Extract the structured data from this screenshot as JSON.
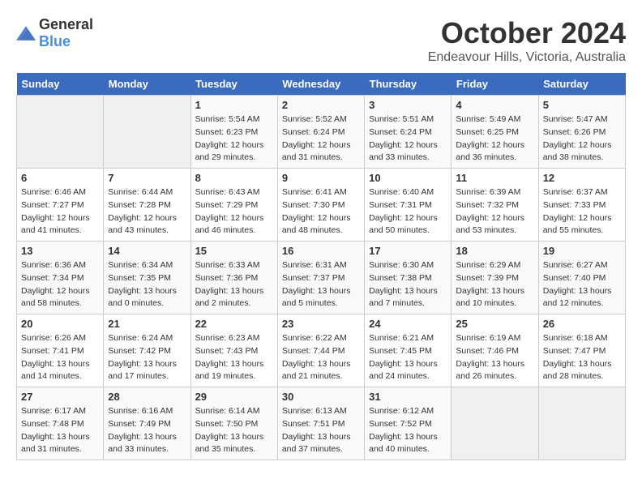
{
  "header": {
    "logo_general": "General",
    "logo_blue": "Blue",
    "month": "October 2024",
    "location": "Endeavour Hills, Victoria, Australia"
  },
  "weekdays": [
    "Sunday",
    "Monday",
    "Tuesday",
    "Wednesday",
    "Thursday",
    "Friday",
    "Saturday"
  ],
  "weeks": [
    [
      {
        "day": "",
        "sunrise": "",
        "sunset": "",
        "daylight": ""
      },
      {
        "day": "",
        "sunrise": "",
        "sunset": "",
        "daylight": ""
      },
      {
        "day": "1",
        "sunrise": "Sunrise: 5:54 AM",
        "sunset": "Sunset: 6:23 PM",
        "daylight": "Daylight: 12 hours and 29 minutes."
      },
      {
        "day": "2",
        "sunrise": "Sunrise: 5:52 AM",
        "sunset": "Sunset: 6:24 PM",
        "daylight": "Daylight: 12 hours and 31 minutes."
      },
      {
        "day": "3",
        "sunrise": "Sunrise: 5:51 AM",
        "sunset": "Sunset: 6:24 PM",
        "daylight": "Daylight: 12 hours and 33 minutes."
      },
      {
        "day": "4",
        "sunrise": "Sunrise: 5:49 AM",
        "sunset": "Sunset: 6:25 PM",
        "daylight": "Daylight: 12 hours and 36 minutes."
      },
      {
        "day": "5",
        "sunrise": "Sunrise: 5:47 AM",
        "sunset": "Sunset: 6:26 PM",
        "daylight": "Daylight: 12 hours and 38 minutes."
      }
    ],
    [
      {
        "day": "6",
        "sunrise": "Sunrise: 6:46 AM",
        "sunset": "Sunset: 7:27 PM",
        "daylight": "Daylight: 12 hours and 41 minutes."
      },
      {
        "day": "7",
        "sunrise": "Sunrise: 6:44 AM",
        "sunset": "Sunset: 7:28 PM",
        "daylight": "Daylight: 12 hours and 43 minutes."
      },
      {
        "day": "8",
        "sunrise": "Sunrise: 6:43 AM",
        "sunset": "Sunset: 7:29 PM",
        "daylight": "Daylight: 12 hours and 46 minutes."
      },
      {
        "day": "9",
        "sunrise": "Sunrise: 6:41 AM",
        "sunset": "Sunset: 7:30 PM",
        "daylight": "Daylight: 12 hours and 48 minutes."
      },
      {
        "day": "10",
        "sunrise": "Sunrise: 6:40 AM",
        "sunset": "Sunset: 7:31 PM",
        "daylight": "Daylight: 12 hours and 50 minutes."
      },
      {
        "day": "11",
        "sunrise": "Sunrise: 6:39 AM",
        "sunset": "Sunset: 7:32 PM",
        "daylight": "Daylight: 12 hours and 53 minutes."
      },
      {
        "day": "12",
        "sunrise": "Sunrise: 6:37 AM",
        "sunset": "Sunset: 7:33 PM",
        "daylight": "Daylight: 12 hours and 55 minutes."
      }
    ],
    [
      {
        "day": "13",
        "sunrise": "Sunrise: 6:36 AM",
        "sunset": "Sunset: 7:34 PM",
        "daylight": "Daylight: 12 hours and 58 minutes."
      },
      {
        "day": "14",
        "sunrise": "Sunrise: 6:34 AM",
        "sunset": "Sunset: 7:35 PM",
        "daylight": "Daylight: 13 hours and 0 minutes."
      },
      {
        "day": "15",
        "sunrise": "Sunrise: 6:33 AM",
        "sunset": "Sunset: 7:36 PM",
        "daylight": "Daylight: 13 hours and 2 minutes."
      },
      {
        "day": "16",
        "sunrise": "Sunrise: 6:31 AM",
        "sunset": "Sunset: 7:37 PM",
        "daylight": "Daylight: 13 hours and 5 minutes."
      },
      {
        "day": "17",
        "sunrise": "Sunrise: 6:30 AM",
        "sunset": "Sunset: 7:38 PM",
        "daylight": "Daylight: 13 hours and 7 minutes."
      },
      {
        "day": "18",
        "sunrise": "Sunrise: 6:29 AM",
        "sunset": "Sunset: 7:39 PM",
        "daylight": "Daylight: 13 hours and 10 minutes."
      },
      {
        "day": "19",
        "sunrise": "Sunrise: 6:27 AM",
        "sunset": "Sunset: 7:40 PM",
        "daylight": "Daylight: 13 hours and 12 minutes."
      }
    ],
    [
      {
        "day": "20",
        "sunrise": "Sunrise: 6:26 AM",
        "sunset": "Sunset: 7:41 PM",
        "daylight": "Daylight: 13 hours and 14 minutes."
      },
      {
        "day": "21",
        "sunrise": "Sunrise: 6:24 AM",
        "sunset": "Sunset: 7:42 PM",
        "daylight": "Daylight: 13 hours and 17 minutes."
      },
      {
        "day": "22",
        "sunrise": "Sunrise: 6:23 AM",
        "sunset": "Sunset: 7:43 PM",
        "daylight": "Daylight: 13 hours and 19 minutes."
      },
      {
        "day": "23",
        "sunrise": "Sunrise: 6:22 AM",
        "sunset": "Sunset: 7:44 PM",
        "daylight": "Daylight: 13 hours and 21 minutes."
      },
      {
        "day": "24",
        "sunrise": "Sunrise: 6:21 AM",
        "sunset": "Sunset: 7:45 PM",
        "daylight": "Daylight: 13 hours and 24 minutes."
      },
      {
        "day": "25",
        "sunrise": "Sunrise: 6:19 AM",
        "sunset": "Sunset: 7:46 PM",
        "daylight": "Daylight: 13 hours and 26 minutes."
      },
      {
        "day": "26",
        "sunrise": "Sunrise: 6:18 AM",
        "sunset": "Sunset: 7:47 PM",
        "daylight": "Daylight: 13 hours and 28 minutes."
      }
    ],
    [
      {
        "day": "27",
        "sunrise": "Sunrise: 6:17 AM",
        "sunset": "Sunset: 7:48 PM",
        "daylight": "Daylight: 13 hours and 31 minutes."
      },
      {
        "day": "28",
        "sunrise": "Sunrise: 6:16 AM",
        "sunset": "Sunset: 7:49 PM",
        "daylight": "Daylight: 13 hours and 33 minutes."
      },
      {
        "day": "29",
        "sunrise": "Sunrise: 6:14 AM",
        "sunset": "Sunset: 7:50 PM",
        "daylight": "Daylight: 13 hours and 35 minutes."
      },
      {
        "day": "30",
        "sunrise": "Sunrise: 6:13 AM",
        "sunset": "Sunset: 7:51 PM",
        "daylight": "Daylight: 13 hours and 37 minutes."
      },
      {
        "day": "31",
        "sunrise": "Sunrise: 6:12 AM",
        "sunset": "Sunset: 7:52 PM",
        "daylight": "Daylight: 13 hours and 40 minutes."
      },
      {
        "day": "",
        "sunrise": "",
        "sunset": "",
        "daylight": ""
      },
      {
        "day": "",
        "sunrise": "",
        "sunset": "",
        "daylight": ""
      }
    ]
  ]
}
